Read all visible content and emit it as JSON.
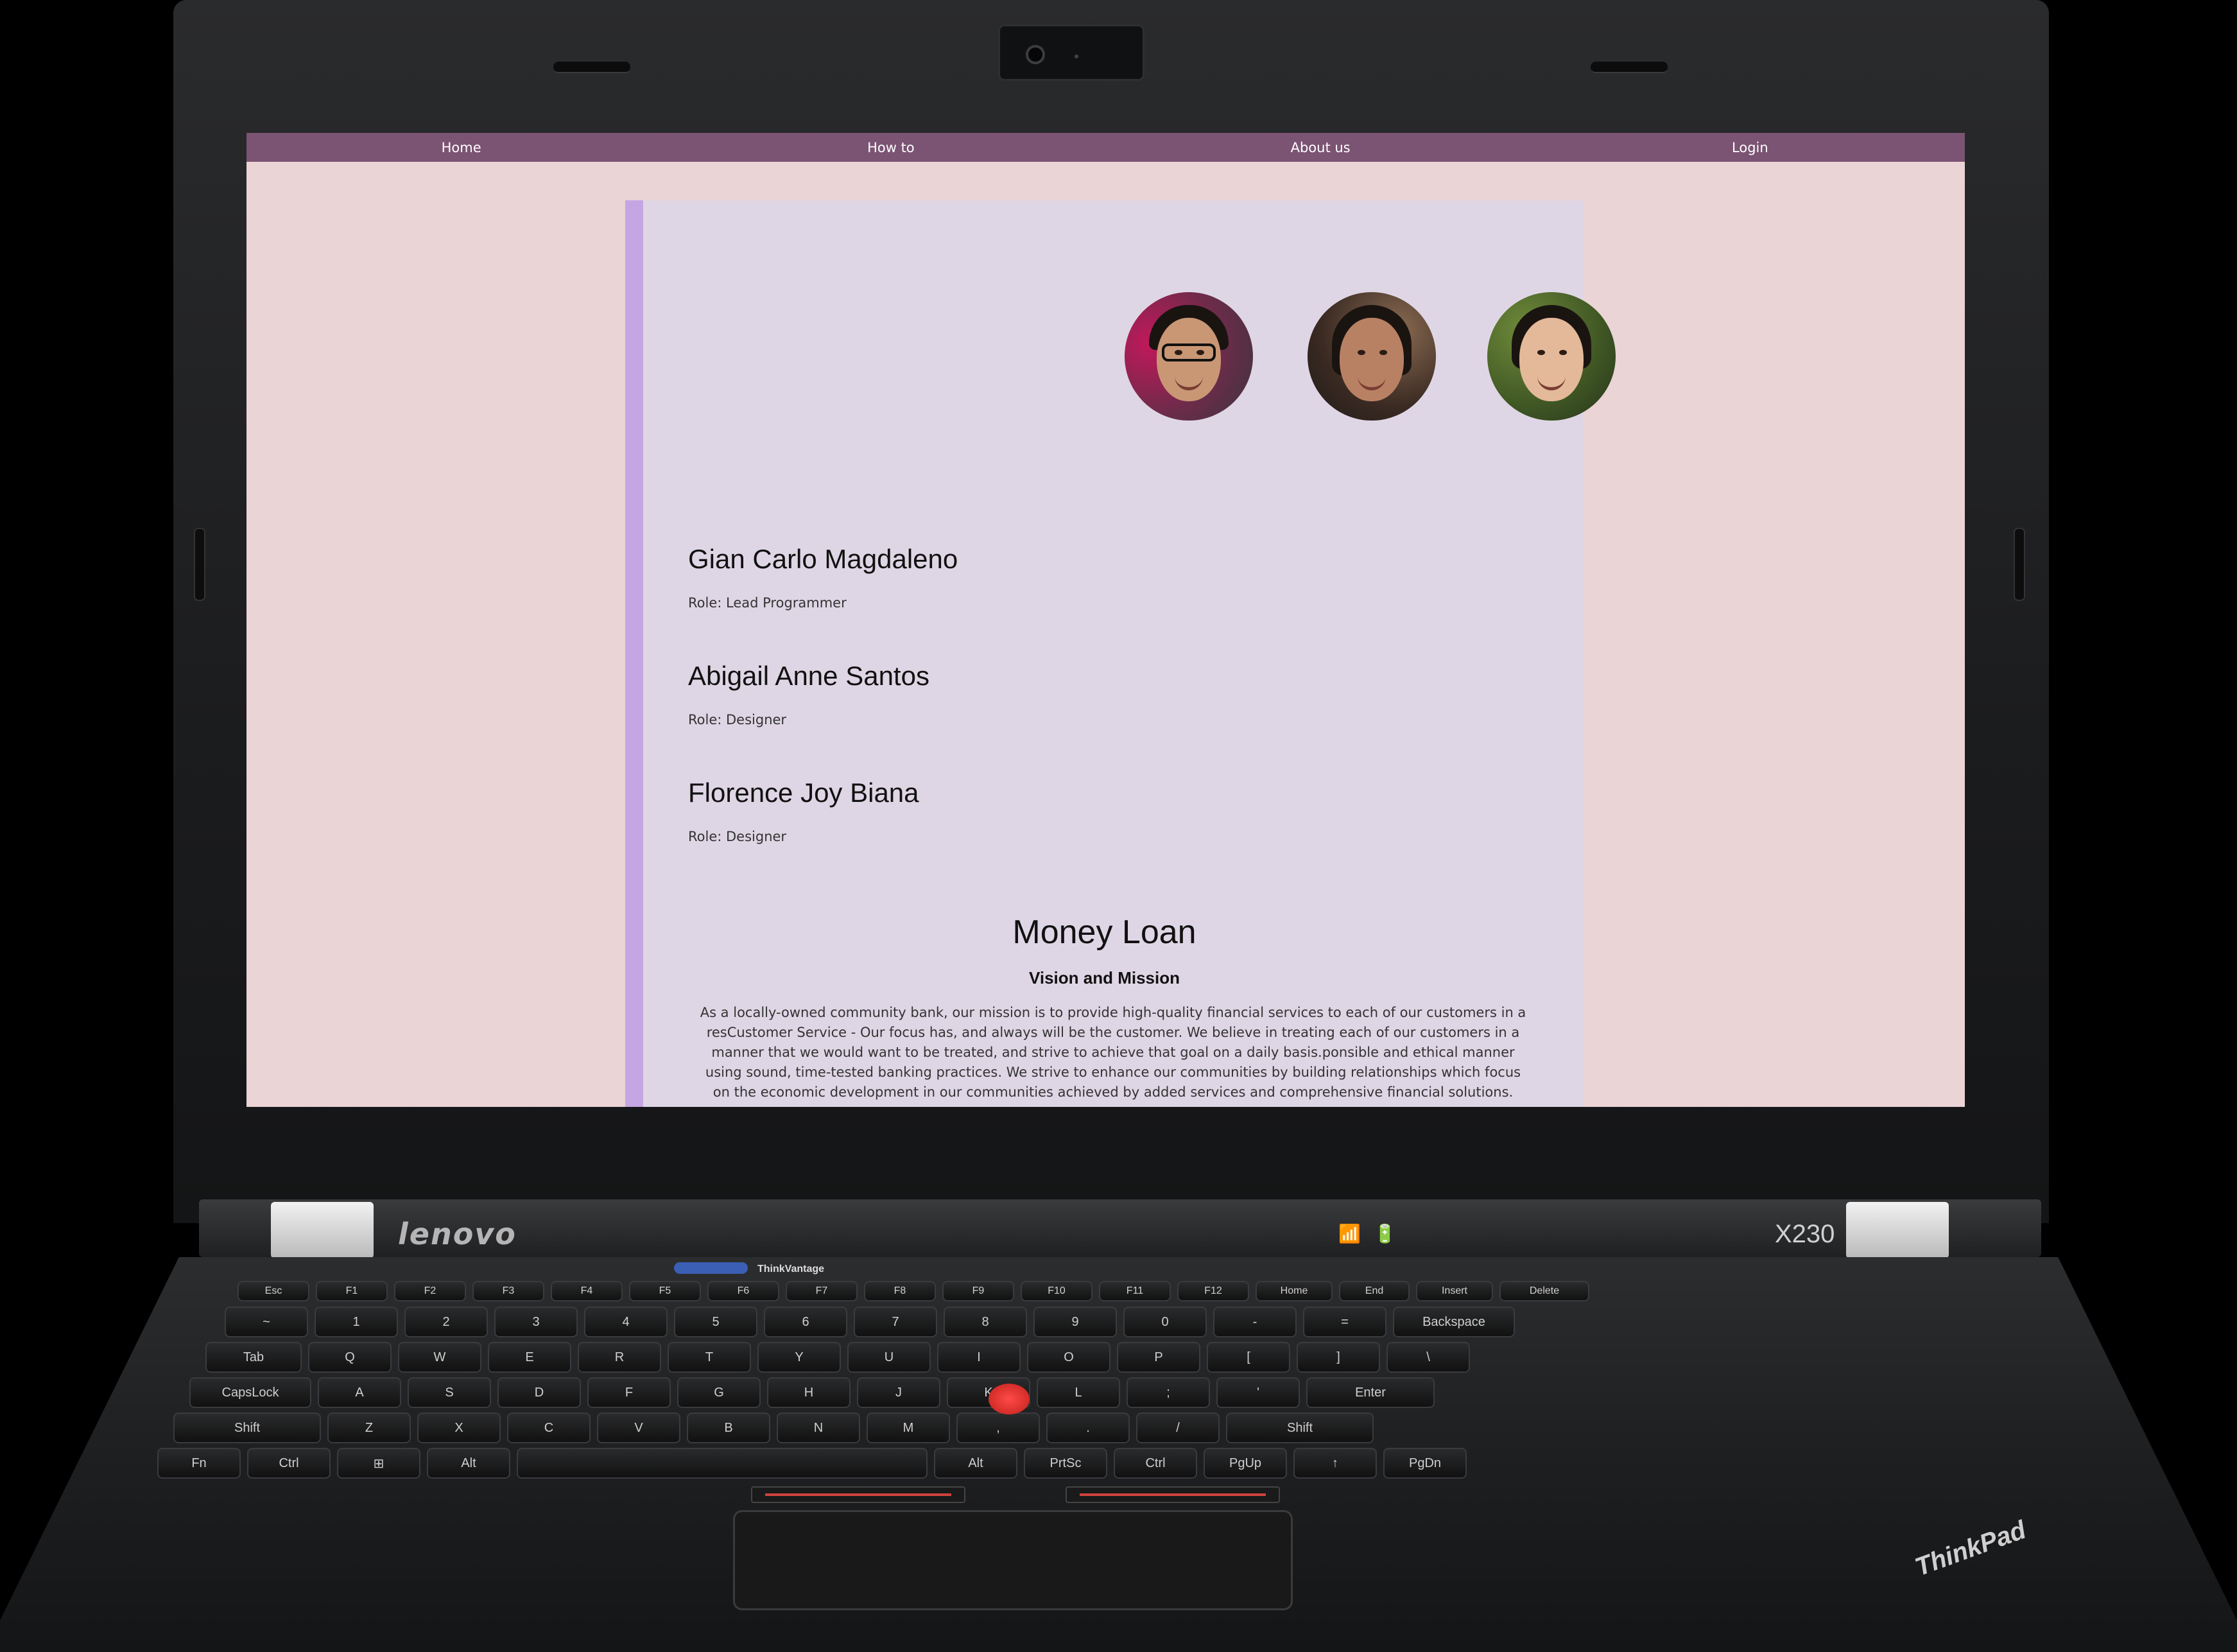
{
  "nav": {
    "items": [
      "Home",
      "How to",
      "About us",
      "Login"
    ]
  },
  "team": [
    {
      "name": "Gian Carlo Magdaleno",
      "role": "Role: Lead Programmer"
    },
    {
      "name": "Abigail Anne Santos",
      "role": "Role: Designer"
    },
    {
      "name": "Florence Joy Biana",
      "role": "Role: Designer"
    }
  ],
  "about": {
    "title": "Money Loan",
    "subtitle": "Vision and Mission",
    "text": "As a locally-owned community bank, our mission is to provide high-quality financial services to each of our customers in a resCustomer Service - Our focus has, and always will be the customer. We believe in treating each of our customers in a manner that we would want to be treated, and strive to achieve that goal on a daily basis.ponsible and ethical manner using sound, time-tested banking practices. We strive to enhance our communities by building relationships which focus on the economic development in our communities achieved by added services and comprehensive financial solutions."
  },
  "laptop": {
    "brand": "lenovo",
    "model": "X230",
    "thinkvantage": "ThinkVantage",
    "thinkpad": "ThinkPad"
  },
  "keys": {
    "row1": [
      "Esc",
      "F1",
      "F2",
      "F3",
      "F4",
      "F5",
      "F6",
      "F7",
      "F8",
      "F9",
      "F10",
      "F11",
      "F12",
      "Home",
      "End",
      "Insert",
      "Delete"
    ],
    "row2": [
      "~",
      "1",
      "2",
      "3",
      "4",
      "5",
      "6",
      "7",
      "8",
      "9",
      "0",
      "-",
      "=",
      "Backspace"
    ],
    "row3": [
      "Tab",
      "Q",
      "W",
      "E",
      "R",
      "T",
      "Y",
      "U",
      "I",
      "O",
      "P",
      "[",
      "]",
      "\\"
    ],
    "row4": [
      "CapsLock",
      "A",
      "S",
      "D",
      "F",
      "G",
      "H",
      "J",
      "K",
      "L",
      ";",
      "'",
      "Enter"
    ],
    "row5": [
      "Shift",
      "Z",
      "X",
      "C",
      "V",
      "B",
      "N",
      "M",
      ",",
      ".",
      "/",
      "Shift"
    ],
    "row6": [
      "Fn",
      "Ctrl",
      "⊞",
      "Alt",
      "",
      "Alt",
      "PrtSc",
      "Ctrl",
      "PgUp",
      "↑",
      "PgDn"
    ]
  }
}
